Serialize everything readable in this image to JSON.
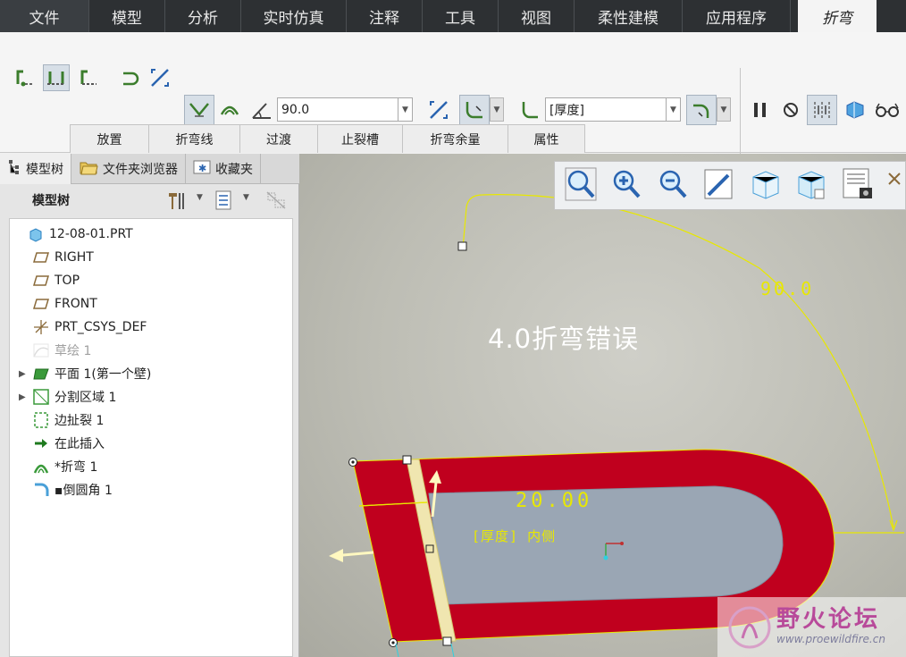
{
  "menu": {
    "items": [
      "文件",
      "模型",
      "分析",
      "实时仿真",
      "注释",
      "工具",
      "视图",
      "柔性建模",
      "应用程序"
    ],
    "active_tab": "折弯"
  },
  "ribbon": {
    "angle_value": "90.0",
    "thickness_value": "[厚度]",
    "tabs": [
      "放置",
      "折弯线",
      "过渡",
      "止裂槽",
      "折弯余量",
      "属性"
    ]
  },
  "left_pane": {
    "tabs": [
      "模型树",
      "文件夹浏览器",
      "收藏夹"
    ],
    "tree_title": "模型树",
    "tree": [
      {
        "label": "12-08-01.PRT",
        "icon": "part-icon",
        "expandable": false,
        "dim": false
      },
      {
        "label": "RIGHT",
        "icon": "datum-plane-icon",
        "expandable": false,
        "dim": false
      },
      {
        "label": "TOP",
        "icon": "datum-plane-icon",
        "expandable": false,
        "dim": false
      },
      {
        "label": "FRONT",
        "icon": "datum-plane-icon",
        "expandable": false,
        "dim": false
      },
      {
        "label": "PRT_CSYS_DEF",
        "icon": "csys-icon",
        "expandable": false,
        "dim": false
      },
      {
        "label": "草绘 1",
        "icon": "sketch-icon",
        "expandable": false,
        "dim": true
      },
      {
        "label": "平面 1(第一个壁)",
        "icon": "flat-wall-icon",
        "expandable": true,
        "dim": false
      },
      {
        "label": "分割区域 1",
        "icon": "split-area-icon",
        "expandable": true,
        "dim": false
      },
      {
        "label": "边扯裂 1",
        "icon": "edge-rip-icon",
        "expandable": false,
        "dim": false
      },
      {
        "label": "在此插入",
        "icon": "insert-here-icon",
        "expandable": false,
        "dim": false
      },
      {
        "label": "*折弯 1",
        "icon": "bend-icon",
        "expandable": false,
        "dim": false
      },
      {
        "label": "▪倒圆角 1",
        "icon": "round-icon",
        "expandable": false,
        "dim": false
      }
    ]
  },
  "graphics": {
    "error_text": "4.0折弯错误",
    "dim_angle": "90.0",
    "dim_length": "20.00",
    "thickness_label": "[厚度] 内侧",
    "watermark_title": "野火论坛",
    "watermark_url": "www.proewildfire.cn"
  },
  "colors": {
    "menu_bg": "#2d3033",
    "part_red": "#c0001e",
    "part_inner": "#9aa6b4",
    "dim_yellow": "#e8e800"
  }
}
